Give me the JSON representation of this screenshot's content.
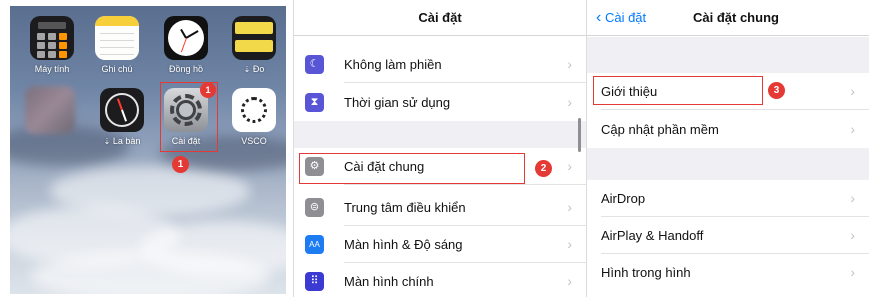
{
  "home_screen": {
    "apps_row1": [
      {
        "label": "Máy tính",
        "icon": "calculator-icon"
      },
      {
        "label": "Ghi chú",
        "icon": "notes-icon"
      },
      {
        "label": "Đồng hồ",
        "icon": "clock-icon"
      },
      {
        "label": "Đo",
        "icon": "measure-icon",
        "cloud": "⇣"
      }
    ],
    "apps_row2": [
      {
        "label": "",
        "icon": "blurred-app-icon"
      },
      {
        "label": "La bàn",
        "icon": "compass-icon",
        "cloud": "⇣"
      },
      {
        "label": "Cài đặt",
        "icon": "settings-gear-icon",
        "badge": "1"
      },
      {
        "label": "VSCO",
        "icon": "vsco-icon"
      }
    ],
    "step_marker": "1"
  },
  "settings": {
    "title": "Cài đặt",
    "rows": [
      {
        "label": "Không làm phiền",
        "icon": "moon-icon",
        "color": "#5856d6"
      },
      {
        "label": "Thời gian sử dụng",
        "icon": "hourglass-icon",
        "color": "#5856d6"
      },
      {
        "label": "Cài đặt chung",
        "icon": "gear-icon",
        "color": "#8e8e93"
      },
      {
        "label": "Trung tâm điều khiển",
        "icon": "toggles-icon",
        "color": "#8e8e93"
      },
      {
        "label": "Màn hình & Độ sáng",
        "icon": "text-size-icon",
        "color": "#1e7cf2",
        "glyph": "AA"
      },
      {
        "label": "Màn hình chính",
        "icon": "home-grid-icon",
        "color": "#3b3bd4"
      }
    ],
    "step_marker": "2"
  },
  "general": {
    "back_label": "Cài đặt",
    "title": "Cài đặt chung",
    "rows": [
      {
        "label": "Giới thiệu"
      },
      {
        "label": "Cập nhật phần mềm"
      },
      {
        "label": "AirDrop"
      },
      {
        "label": "AirPlay & Handoff"
      },
      {
        "label": "Hình trong hình"
      }
    ],
    "step_marker": "3"
  },
  "colors": {
    "highlight": "#e53935",
    "ios_blue": "#007aff",
    "group_gap": "#efeff4"
  }
}
